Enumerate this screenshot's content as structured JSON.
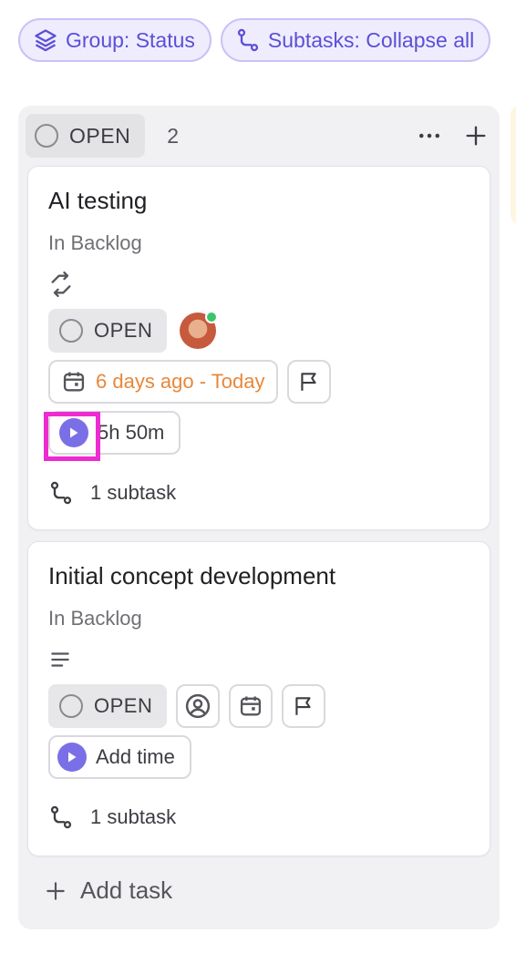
{
  "toolbar": {
    "group_label": "Group: Status",
    "subtasks_label": "Subtasks: Collapse all"
  },
  "column": {
    "status": "OPEN",
    "count": "2",
    "add_task": "Add task"
  },
  "tasks": [
    {
      "title": "AI testing",
      "list": "In Backlog",
      "status": "OPEN",
      "date": "6 days ago - Today",
      "time": "5h 50m",
      "subtasks": "1 subtask"
    },
    {
      "title": "Initial concept development",
      "list": "In Backlog",
      "status": "OPEN",
      "time": "Add time",
      "subtasks": "1 subtask"
    }
  ],
  "colors": {
    "accent": "#7b6fe8",
    "chip_text": "#5b4fd6",
    "date_overdue": "#e8873a",
    "highlight": "#ee2bd0",
    "online": "#3cc46b"
  }
}
